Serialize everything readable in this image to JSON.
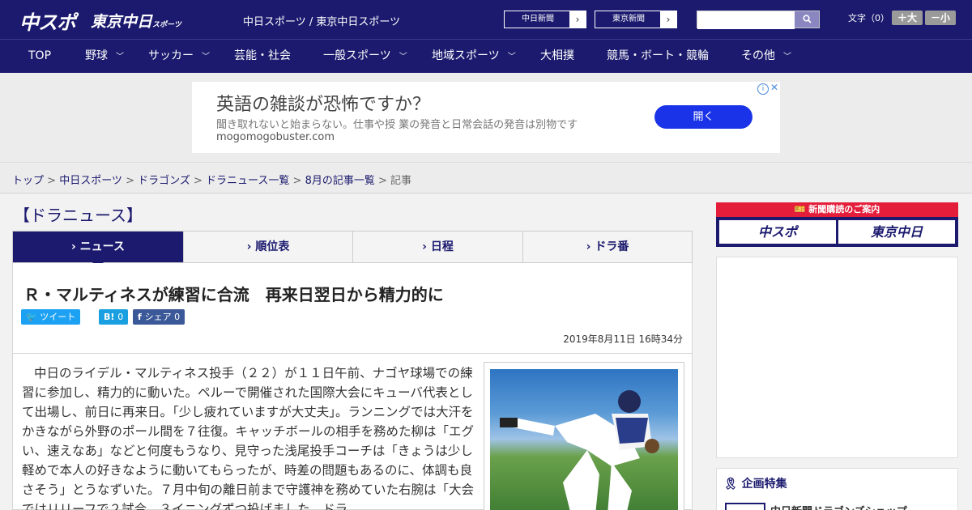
{
  "header": {
    "logo_main": "中スポ",
    "logo_sub": "東京中日",
    "logo_sub_small": "スポーツ",
    "site_name": "中日スポーツ / 東京中日スポーツ",
    "link1": "中日新聞",
    "link2": "東京新聞",
    "search_placeholder": "",
    "font_label": "文字（0）",
    "font_larger": "＋大",
    "font_smaller": "－小"
  },
  "nav": {
    "items": [
      "TOP",
      "野球",
      "サッカー",
      "芸能・社会",
      "一般スポーツ",
      "地域スポーツ",
      "大相撲",
      "競馬・ボート・競輪",
      "その他"
    ]
  },
  "ad": {
    "title": "英語の雑談が恐怖ですか？",
    "desc": "聞き取れないと始まらない。仕事や授 業の発音と日常会話の発音は別物です",
    "url": "mogomogobuster.com",
    "open_label": "開く"
  },
  "breadcrumb": {
    "items": [
      "トップ",
      "中日スポーツ",
      "ドラゴンズ",
      "ドラニュース一覧",
      "8月の記事一覧"
    ],
    "current": "記事"
  },
  "section_title": "【ドラニュース】",
  "tabs": [
    "ニュース",
    "順位表",
    "日程",
    "ドラ番"
  ],
  "article": {
    "headline": "Ｒ・マルティネスが練習に合流　再来日翌日から精力的に",
    "share_tweet": "ツイート",
    "share_hatena": "0",
    "share_fb": "シェア 0",
    "date": "2019年8月11日 16時34分",
    "body": "中日のライデル・マルティネス投手（２２）が１１日午前、ナゴヤ球場での練習に参加し、精力的に動いた。ペルーで開催された国際大会にキューバ代表として出場し、前日に再来日。「少し疲れていますが大丈夫」。ランニングでは大汗をかきながら外野のポール間を７往復。キャッチボールの相手を務めた柳は「エグい、速えなあ」などと何度もうなり、見守った浅尾投手コーチは「きょうは少し軽めで本人の好きなように動いてもらったが、時差の問題もあるのに、体調も良さそう」とうなずいた。７月中旬の離日前まで守護神を務めていた右腕は「大会ではリリーフで２試合、３イニングずつ投げました。ドラ"
  },
  "sidebar": {
    "subscribe_label": "新聞購読のご案内",
    "sub_btn1": "中スポ",
    "sub_btn2": "東京中日",
    "special_title": "企画特集",
    "special_item": "中日新聞ドラゴンズショップ"
  },
  "colors": {
    "brand": "#1b1a6e",
    "ad_button": "#1a33e8",
    "subscribe_red": "#e41e3a"
  }
}
